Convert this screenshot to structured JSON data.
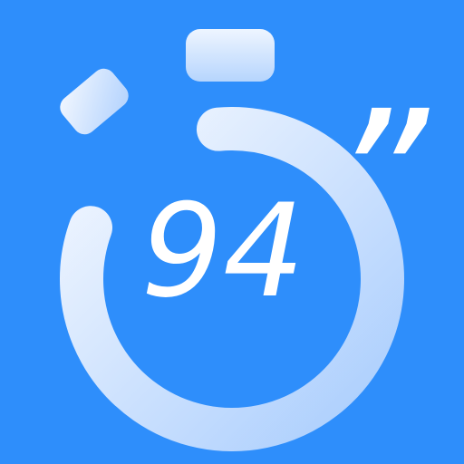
{
  "icon": {
    "name": "stopwatch-app-icon",
    "glyph": "stopwatch-icon",
    "colors": {
      "background": "#2e8efb",
      "ring_light": "#f4f8ff",
      "ring_shade": "#a9cdfd",
      "button_light": "#eef5ff",
      "button_shade": "#b6d5fd"
    }
  },
  "timer": {
    "value": "94",
    "unit": "”",
    "ring_progress": 0.82
  }
}
